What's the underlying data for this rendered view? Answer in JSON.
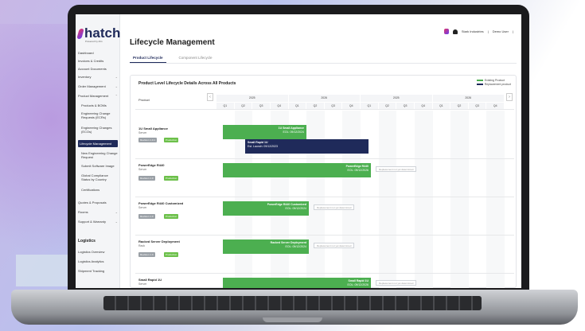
{
  "app": {
    "logo_text": "hatch",
    "logo_sub": "Powered by AIG"
  },
  "header": {
    "page_title": "Lifecycle Management",
    "org": "Stark Industries",
    "user": "Demo User"
  },
  "tabs": [
    {
      "label": "Product Lifecycle",
      "active": true
    },
    {
      "label": "Component Lifecycle",
      "active": false
    }
  ],
  "sidebar": {
    "items": [
      {
        "label": "Dashboard"
      },
      {
        "label": "Invoices & Credits"
      },
      {
        "label": "Account Documents"
      },
      {
        "label": "Inventory"
      },
      {
        "label": "Order Management"
      },
      {
        "label": "Product Management"
      },
      {
        "label": "Products & BOMs"
      },
      {
        "label": "Engineering Change Requests (ECRs)"
      },
      {
        "label": "Engineering Changes (ECOs)"
      },
      {
        "label": "Lifecycle Management",
        "active": true
      },
      {
        "label": "New Engineering Change Request"
      },
      {
        "label": "Submit Software Image"
      },
      {
        "label": "Global Compliance Status by Country"
      },
      {
        "label": "Certifications"
      },
      {
        "label": "Quotes & Proposals"
      },
      {
        "label": "Rooms"
      },
      {
        "label": "Support & Warranty"
      }
    ],
    "section_logistics": "Logistics",
    "logistics_items": [
      {
        "label": "Logistics Overview"
      },
      {
        "label": "Logistics Analytics"
      },
      {
        "label": "Shipment Tracking"
      }
    ]
  },
  "card": {
    "title": "Product Level Lifecycle Details Across All Products",
    "legend": [
      {
        "label": "Existing Product",
        "color": "#4caf50"
      },
      {
        "label": "Replacement product",
        "color": "#1f2a5a"
      }
    ],
    "product_col_header": "Product",
    "years": [
      "2025",
      "2026",
      "2025",
      "2026"
    ],
    "quarters": [
      "Q1",
      "Q2",
      "Q3",
      "Q4",
      "Q1",
      "Q2",
      "Q3",
      "Q4",
      "Q1",
      "Q2",
      "Q3",
      "Q4",
      "Q1",
      "Q2",
      "Q3",
      "Q4"
    ],
    "prev_arrow": "‹",
    "next_arrow": "›"
  },
  "products": [
    {
      "name": "1U Small Appliance",
      "type": "Server",
      "version": "Revision 1.0.1",
      "status": "Production",
      "bar_label": "1U Small Appliance",
      "bar_sub": "EOL: 09/12/2024",
      "replacement": {
        "label": "Small Rapid 1U",
        "sub": "Est. Launch: 09/12/2023"
      }
    },
    {
      "name": "PowerEdge R440",
      "type": "Server",
      "version": "Revision 1.0",
      "status": "Production",
      "bar_label": "PowerEdge R440",
      "bar_sub": "EOL: 09/12/2026",
      "ghost": "Replacement not yet determined"
    },
    {
      "name": "PowerEdge R440 Customized",
      "type": "Server",
      "version": "Revision 1.0",
      "status": "Production",
      "bar_label": "PowerEdge R440 Customized",
      "bar_sub": "EOL: 09/12/2024",
      "ghost": "Replacement not yet determined"
    },
    {
      "name": "Racked Server Deployment",
      "type": "Rack",
      "version": "Revision 1.0",
      "status": "Production",
      "bar_label": "Racked Server Deployment",
      "bar_sub": "EOL: 09/12/2024",
      "ghost": "Replacement not yet determined"
    },
    {
      "name": "Small Rapid 1U",
      "type": "Server",
      "version": "Revision 1.0",
      "status": "Production",
      "bar_label": "Small Rapid 1U",
      "bar_sub": "EOL: 09/12/2026",
      "ghost": "Replacement not yet determined"
    }
  ]
}
